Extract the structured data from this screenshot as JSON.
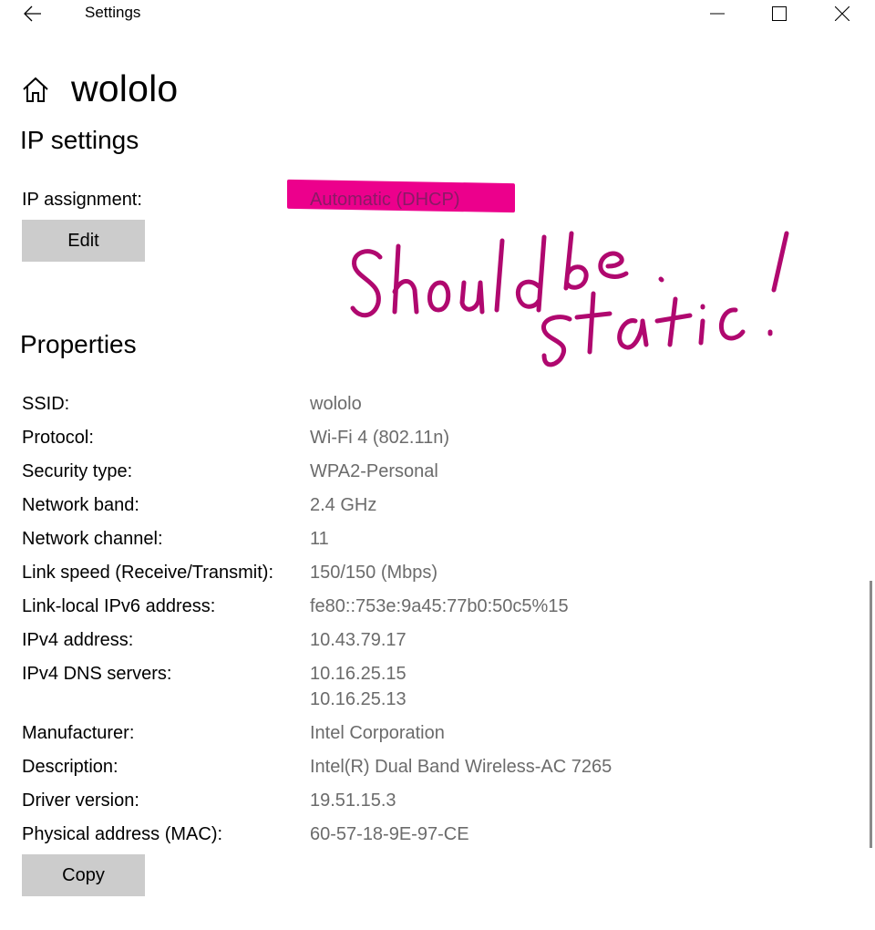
{
  "window": {
    "app_title": "Settings",
    "buttons": {
      "minimize": "minimize-icon",
      "maximize": "maximize-icon",
      "close": "close-icon"
    }
  },
  "header": {
    "title": "wololo",
    "home_icon": "home-icon",
    "back_icon": "back-arrow-icon"
  },
  "ip_settings": {
    "section_title": "IP settings",
    "assignment_label": "IP assignment:",
    "assignment_value": "Automatic (DHCP)",
    "edit_button": "Edit",
    "highlight_color": "#ec008c"
  },
  "annotation": {
    "text": "Should be static!",
    "color": "#b0086f"
  },
  "properties": {
    "section_title": "Properties",
    "rows": [
      {
        "label": "SSID:",
        "value": "wololo"
      },
      {
        "label": "Protocol:",
        "value": "Wi-Fi 4 (802.11n)"
      },
      {
        "label": "Security type:",
        "value": "WPA2-Personal"
      },
      {
        "label": "Network band:",
        "value": "2.4 GHz"
      },
      {
        "label": "Network channel:",
        "value": "11"
      },
      {
        "label": "Link speed (Receive/Transmit):",
        "value": "150/150 (Mbps)"
      },
      {
        "label": "Link-local IPv6 address:",
        "value": "fe80::753e:9a45:77b0:50c5%15"
      },
      {
        "label": "IPv4 address:",
        "value": "10.43.79.17"
      },
      {
        "label": "IPv4 DNS servers:",
        "value": "10.16.25.15",
        "value2": "10.16.25.13"
      },
      {
        "label": "Manufacturer:",
        "value": "Intel Corporation"
      },
      {
        "label": "Description:",
        "value": "Intel(R) Dual Band Wireless-AC 7265"
      },
      {
        "label": "Driver version:",
        "value": "19.51.15.3"
      },
      {
        "label": "Physical address (MAC):",
        "value": "60-57-18-9E-97-CE"
      }
    ],
    "copy_button": "Copy"
  }
}
